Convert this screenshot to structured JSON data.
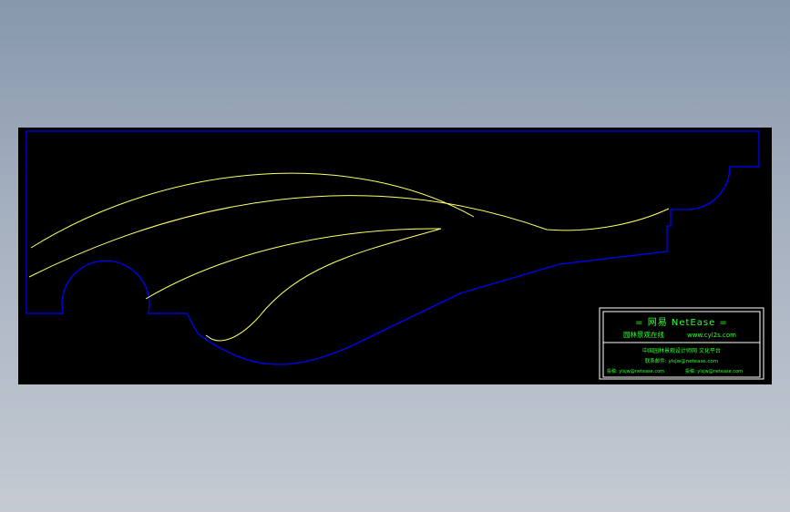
{
  "title_block": {
    "header": "= 网易 NetEase =",
    "line1_left": "园林景观在线",
    "line1_right": "www.cyl2s.com",
    "line2": "中国园林景观设计师网 文化平台",
    "line3": "联系邮件: ylsjw@netease.com",
    "line4_left": "投稿: ylsjw@netease.com",
    "line4_right": "投稿: ylsjw@netease.com"
  },
  "colors": {
    "background": "#000000",
    "outline": "#0000ff",
    "curves": "#ffff66",
    "frame": "#ffffff",
    "text": "#33ff33"
  }
}
